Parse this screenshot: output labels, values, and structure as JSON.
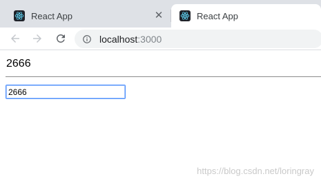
{
  "tabs": [
    {
      "title": "React App",
      "active": false
    },
    {
      "title": "React App",
      "active": true
    }
  ],
  "tab_close_glyph": "✕",
  "icons": {
    "favicon": "react-logo-icon",
    "back": "arrow-left-icon",
    "forward": "arrow-right-icon",
    "reload": "reload-icon",
    "site_info": "info-circle-icon",
    "tab_close": "close-icon"
  },
  "address_bar": {
    "host": "localhost",
    "port": ":3000"
  },
  "page": {
    "heading": "2666",
    "input_value": "2666"
  },
  "watermark": "https://blog.csdn.net/loringray",
  "colors": {
    "tabstrip_bg": "#dee1e6",
    "react_cyan": "#61dafb",
    "focus_border": "#4d90fe"
  }
}
